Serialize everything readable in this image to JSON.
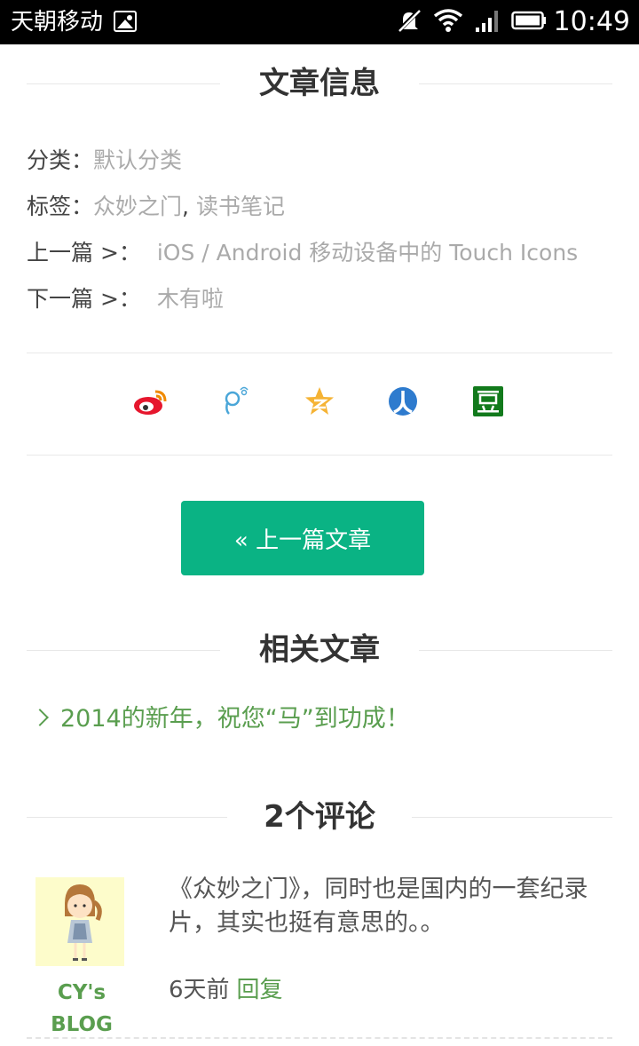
{
  "status_bar": {
    "carrier": "天朝移动",
    "time": "10:49"
  },
  "article_info": {
    "title": "文章信息",
    "category_label": "分类：",
    "category_value": "默认分类",
    "tags_label": "标签：",
    "tags": [
      "众妙之门",
      "读书笔记"
    ],
    "tags_sep": ", ",
    "prev_label": "上一篇 >：",
    "prev_value": "iOS / Android 移动设备中的 Touch Icons",
    "next_label": "下一篇 >：",
    "next_value": "木有啦"
  },
  "share_icons": [
    "weibo-icon",
    "tencent-weibo-icon",
    "qzone-icon",
    "renren-icon",
    "douban-icon"
  ],
  "share_colors": {
    "weibo": "#e6162d",
    "tencent": "#4aa6d8",
    "qzone": "#f5b335",
    "renren": "#2e7bce",
    "douban": "#127a1c"
  },
  "prev_button": "« 上一篇文章",
  "related": {
    "title": "相关文章",
    "items": [
      "2014的新年，祝您“马”到功成！"
    ]
  },
  "comments": {
    "title": "2个评论",
    "items": [
      {
        "author": "CY's BLOG",
        "text": "《众妙之门》，同时也是国内的一套纪录片，其实也挺有意思的。。",
        "time": "6天前",
        "reply": "回复"
      }
    ]
  },
  "colors": {
    "accent": "#0ab384",
    "link": "#5a9e4f"
  }
}
